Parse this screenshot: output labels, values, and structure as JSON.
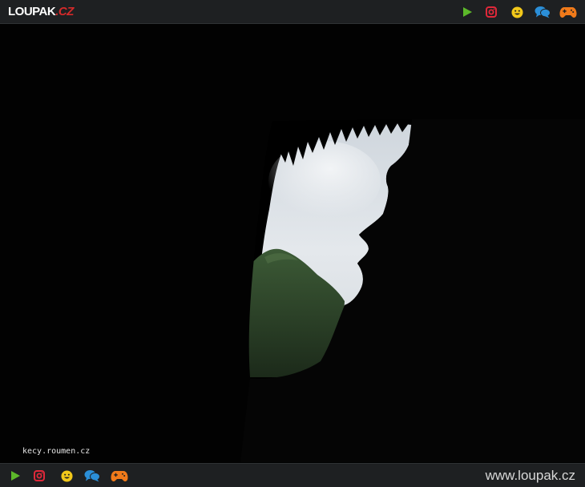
{
  "header": {
    "logo": {
      "main": "LOUPAK",
      "tld": ".CZ"
    },
    "icons": [
      {
        "name": "play-icon",
        "color": "#5cb82a"
      },
      {
        "name": "instagram-icon",
        "color": "#e0283a"
      },
      {
        "name": "smiley-icon",
        "color": "#f2c81a"
      },
      {
        "name": "chat-bubbles-icon",
        "color": "#2b8fd8"
      },
      {
        "name": "gamepad-icon",
        "color": "#f07a1a"
      }
    ]
  },
  "image": {
    "watermark": "kecy.roumen.cz"
  },
  "footer": {
    "site_url": "www.loupak.cz"
  },
  "colors": {
    "bar_background": "#1e2022",
    "page_background": "#000000"
  }
}
